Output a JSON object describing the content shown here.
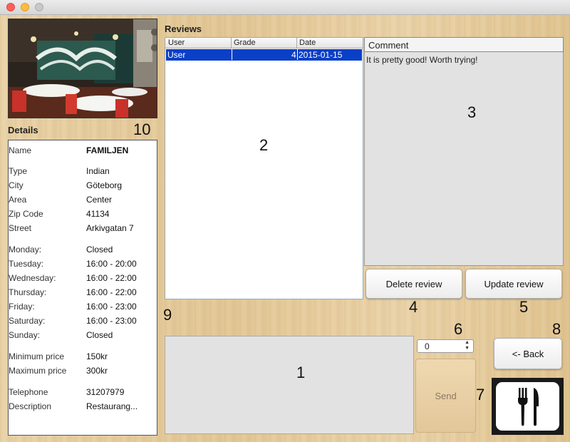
{
  "window": {
    "controls": [
      "close",
      "minimize",
      "maximize"
    ]
  },
  "reviews_section": {
    "title": "Reviews"
  },
  "details_section": {
    "title": "Details"
  },
  "markers": {
    "m1": "1",
    "m2": "2",
    "m3": "3",
    "m4": "4",
    "m5": "5",
    "m6": "6",
    "m7": "7",
    "m8": "8",
    "m9": "9",
    "m10": "10"
  },
  "details": {
    "name": {
      "label": "Name",
      "value": "FAMILJEN"
    },
    "type": {
      "label": "Type",
      "value": "Indian"
    },
    "city": {
      "label": "City",
      "value": "Göteborg"
    },
    "area": {
      "label": "Area",
      "value": "Center"
    },
    "zip": {
      "label": "Zip Code",
      "value": "41134"
    },
    "street": {
      "label": "Street",
      "value": "Arkivgatan 7"
    },
    "monday": {
      "label": "Monday:",
      "value": "Closed"
    },
    "tuesday": {
      "label": "Tuesday:",
      "value": "16:00 - 20:00"
    },
    "wednesday": {
      "label": "Wednesday:",
      "value": "16:00 - 22:00"
    },
    "thursday": {
      "label": "Thursday:",
      "value": "16:00 - 22:00"
    },
    "friday": {
      "label": "Friday:",
      "value": "16:00 - 23:00"
    },
    "saturday": {
      "label": "Saturday:",
      "value": "16:00 - 23:00"
    },
    "sunday": {
      "label": "Sunday:",
      "value": "Closed"
    },
    "min_price": {
      "label": "Minimum price",
      "value": "150kr"
    },
    "max_price": {
      "label": "Maximum price",
      "value": "300kr"
    },
    "telephone": {
      "label": "Telephone",
      "value": "31207979"
    },
    "description": {
      "label": "Description",
      "value": "Restaurang..."
    }
  },
  "reviews_table": {
    "columns": [
      "User",
      "Grade",
      "Date"
    ],
    "rows": [
      {
        "user": "User",
        "grade": "4",
        "date": "2015-01-15"
      }
    ]
  },
  "comment": {
    "header": "Comment",
    "text": "It is pretty good! Worth trying!"
  },
  "buttons": {
    "delete_review": "Delete review",
    "update_review": "Update review",
    "back": "<- Back",
    "send": "Send"
  },
  "grade_spinner": {
    "value": "0"
  },
  "colors": {
    "selection": "#0a3fc8",
    "background": "#e6cc9e"
  },
  "icons": {
    "logo": "fork-knife-icon"
  }
}
